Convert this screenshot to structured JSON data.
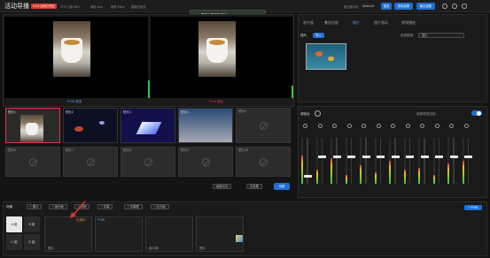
{
  "header": {
    "title": "活动导播",
    "badge": "3.4.5 活动已开启",
    "stats": [
      "CPU 占用 38%",
      "网络 3ms",
      "帧率 25fps",
      "直播与推流"
    ],
    "right_label": "断流倒计时",
    "timer": "00:44:43",
    "btn_push": "推流",
    "btn_record": "录制设置",
    "btn_output": "输出设置"
  },
  "toast": "导播元素保存成功!",
  "monitors": {
    "pvw_label": "PVW 预览",
    "pgm_label": "PGM 输出"
  },
  "slots": [
    {
      "num": "镜头1"
    },
    {
      "num": "镜头2"
    },
    {
      "num": "镜头3"
    },
    {
      "num": "镜头4"
    },
    {
      "num": "镜头5"
    }
  ],
  "empty_slots": [
    "镜头6",
    "镜头7",
    "镜头8",
    "镜头9",
    "镜头10"
  ],
  "transition": {
    "select": "画面淡出",
    "mode": "无效果",
    "button": "切换"
  },
  "right_tabs": [
    "画中画",
    "叠加功能",
    "插片",
    "图片滚动",
    "视频播放"
  ],
  "insert": {
    "title": "插片",
    "btn": "导入",
    "select_label": "选择图册:",
    "select_val": "插片"
  },
  "mixer": {
    "title": "调音台",
    "label": "音频混音控制",
    "channels": [
      "1",
      "2",
      "3",
      "4",
      "5",
      "6",
      "7",
      "8",
      "9",
      "10",
      "11",
      "12"
    ]
  },
  "scene": {
    "title": "场景",
    "buttons": [
      "+ 图片",
      "+ 画中画",
      "+ 视频",
      "+ 字幕",
      "+ 字幕框",
      "+ 比分板"
    ],
    "ab": [
      "A 组",
      "B 组",
      "C 组",
      "D 组"
    ],
    "items": [
      "图片",
      "",
      "画中画",
      "图片"
    ],
    "pvw": "+ PVW",
    "item_badge": "已选中",
    "item_badge2": "PVW"
  },
  "colors": {
    "accent": "#1f6fd6",
    "live": "#e0354a",
    "ok": "#39c24a"
  }
}
